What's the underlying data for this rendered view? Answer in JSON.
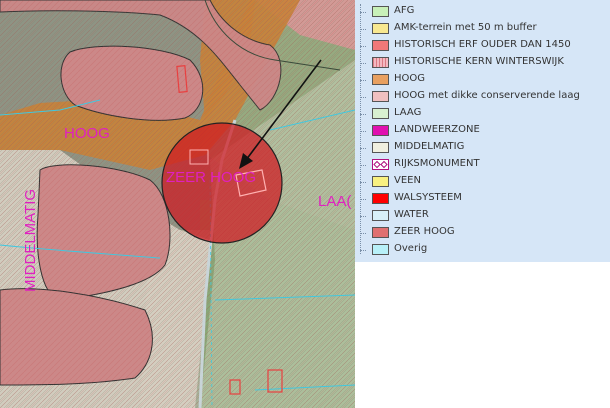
{
  "map": {
    "labels": {
      "hoog": "HOOG",
      "zeer_hoog": "ZEER HOOG",
      "middelmatig": "MIDDELMATIG",
      "laag": "LAA("
    },
    "label_color": "#e020c0",
    "arrow": "arrow-pointer"
  },
  "legend": {
    "items": [
      {
        "label": "AFG",
        "color": "#c8f0b8",
        "pattern": "solid"
      },
      {
        "label": "AMK-terrein met 50 m buffer",
        "color": "#f8e890",
        "pattern": "solid"
      },
      {
        "label": "HISTORISCH ERF OUDER DAN 1450",
        "color": "#f07878",
        "pattern": "solid"
      },
      {
        "label": "HISTORISCHE KERN WINTERSWIJK",
        "color": "#f4b8c0",
        "pattern": "hatched"
      },
      {
        "label": "HOOG",
        "color": "#e8a060",
        "pattern": "solid"
      },
      {
        "label": "HOOG met dikke conserverende laag",
        "color": "#f0c0c0",
        "pattern": "solid"
      },
      {
        "label": "LAAG",
        "color": "#d8f0d0",
        "pattern": "solid"
      },
      {
        "label": "LANDWEERZONE",
        "color": "#e010b0",
        "pattern": "solid"
      },
      {
        "label": "MIDDELMATIG",
        "color": "#f0f0e0",
        "pattern": "solid"
      },
      {
        "label": "RIJKSMONUMENT",
        "color": "#ffffff",
        "pattern": "diamonds"
      },
      {
        "label": "VEEN",
        "color": "#f8f080",
        "pattern": "solid"
      },
      {
        "label": "WALSYSTEEM",
        "color": "#ff0000",
        "pattern": "solid"
      },
      {
        "label": "WATER",
        "color": "#d8f0f8",
        "pattern": "solid"
      },
      {
        "label": "ZEER HOOG",
        "color": "#e07070",
        "pattern": "solid"
      },
      {
        "label": "Overig",
        "color": "#b8f0f8",
        "pattern": "solid"
      }
    ]
  }
}
